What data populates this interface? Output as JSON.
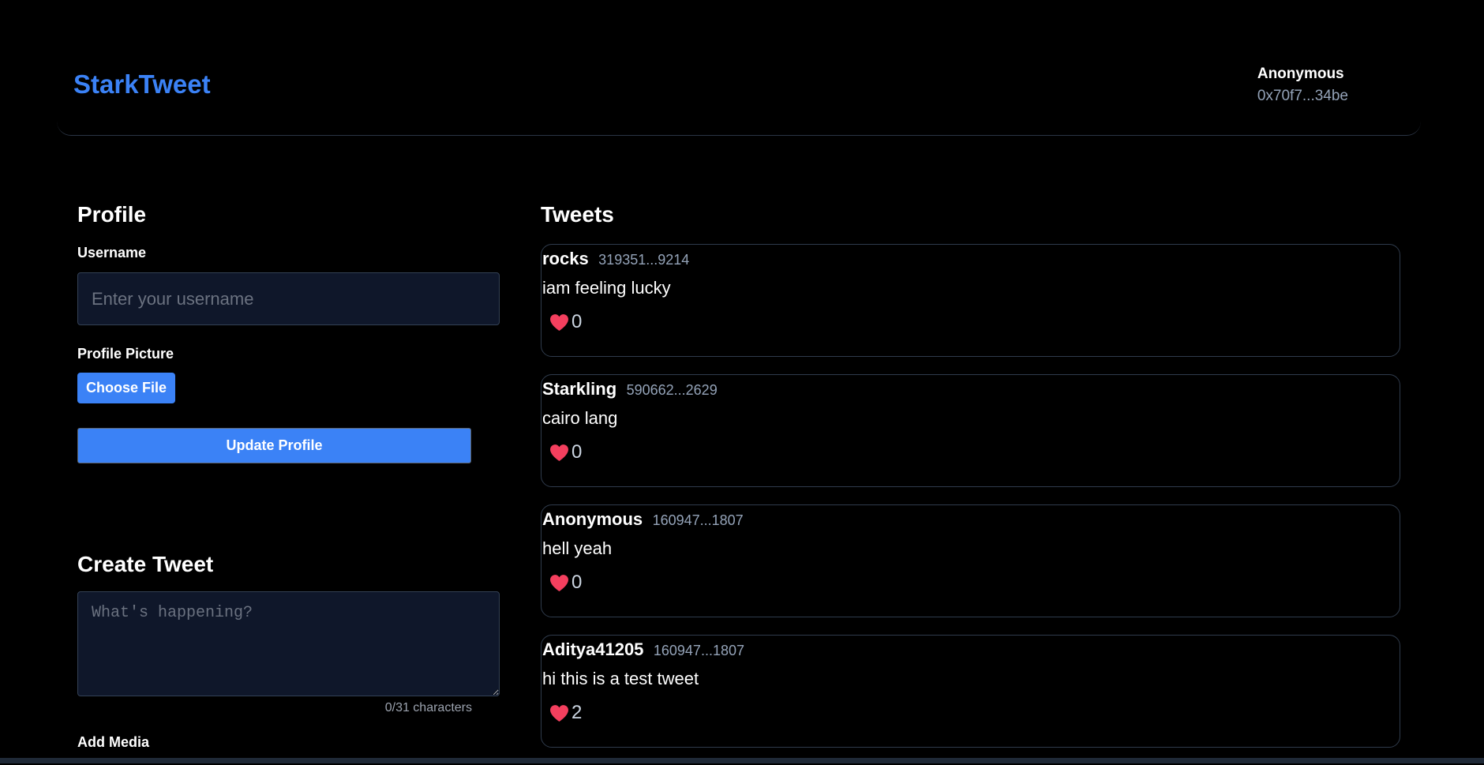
{
  "header": {
    "brand": "StarkTweet",
    "user_name": "Anonymous",
    "user_address": "0x70f7...34be"
  },
  "profile": {
    "title": "Profile",
    "username_label": "Username",
    "username_placeholder": "Enter your username",
    "picture_label": "Profile Picture",
    "choose_file_label": "Choose File",
    "update_button": "Update Profile"
  },
  "create_tweet": {
    "title": "Create Tweet",
    "placeholder": "What's happening?",
    "char_count": "0/31 characters",
    "add_media_label": "Add Media"
  },
  "tweets": {
    "title": "Tweets",
    "items": [
      {
        "user": "rocks",
        "address": "319351...9214",
        "text": "iam feeling lucky",
        "likes": "0"
      },
      {
        "user": "Starkling",
        "address": "590662...2629",
        "text": "cairo lang",
        "likes": "0"
      },
      {
        "user": "Anonymous",
        "address": "160947...1807",
        "text": "hell yeah",
        "likes": "0"
      },
      {
        "user": "Aditya41205",
        "address": "160947...1807",
        "text": "hi this is a test tweet",
        "likes": "2"
      }
    ]
  },
  "colors": {
    "accent": "#3b82f6",
    "background": "#000000",
    "input_bg": "#0f172a",
    "heart": "#f43f5e"
  },
  "icons": {
    "like": "heart-icon"
  }
}
